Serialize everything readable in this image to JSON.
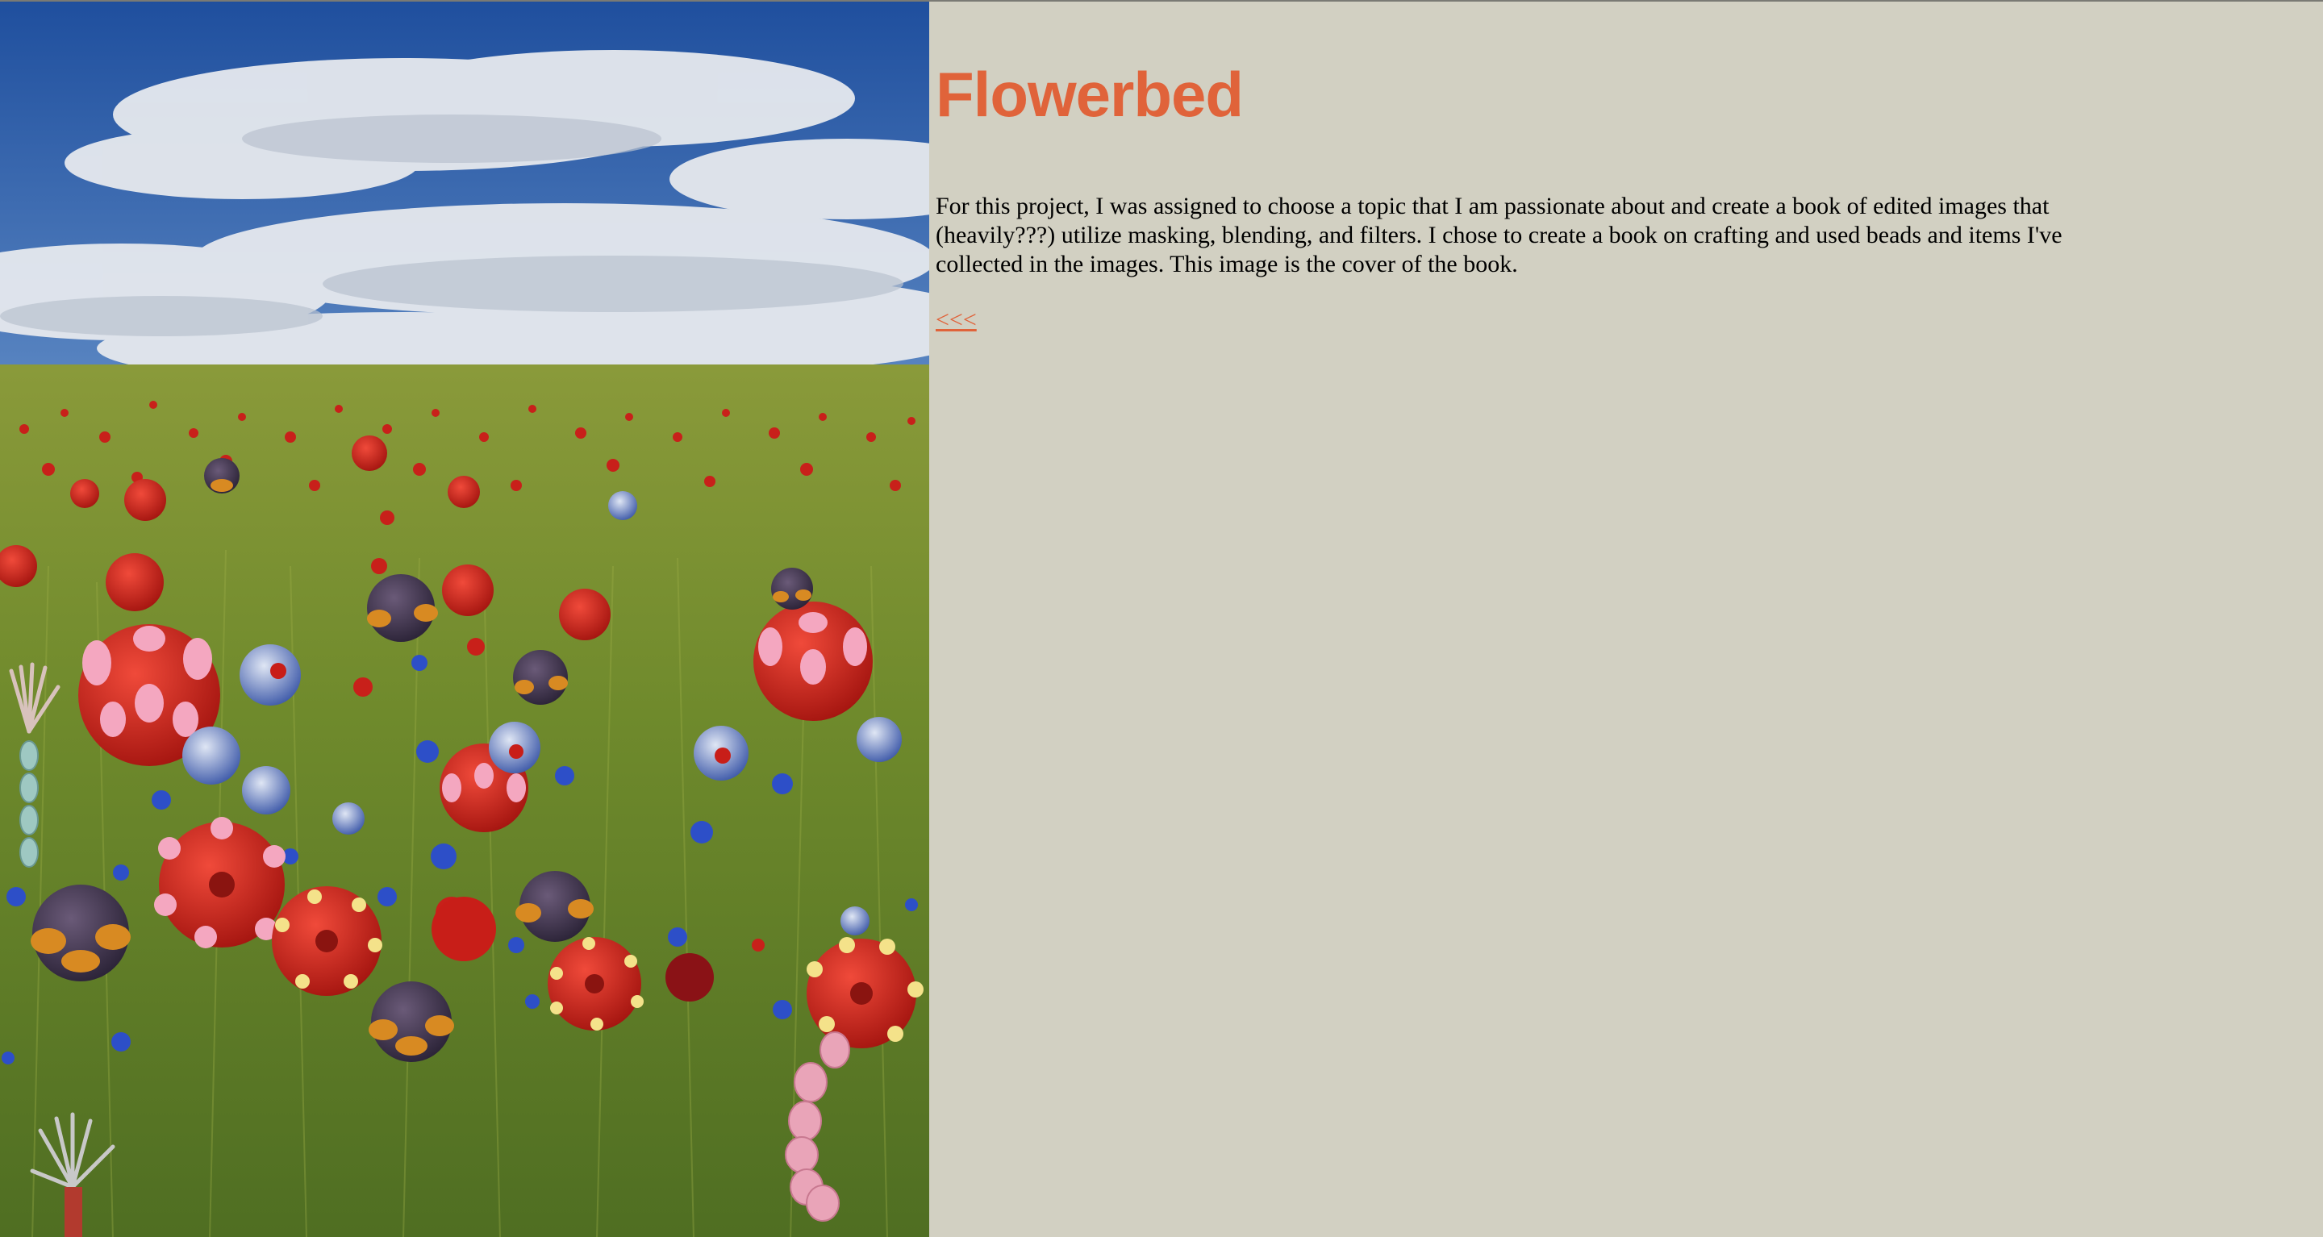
{
  "page": {
    "title": "Flowerbed",
    "description": "For this project, I was assigned to choose a topic that I am passionate about and create a book of edited images that (heavily???) utilize masking, blending, and filters. I chose to create a book on crafting and used beads and items I've collected in the images. This image is the cover of the book.",
    "back_link": "<<<"
  },
  "colors": {
    "accent": "#e0633a",
    "background": "#d2d0c2",
    "sky": "#2f64b2",
    "field": "#6f8a2c"
  },
  "image": {
    "subject": "flowerbed-collage",
    "bead_colors": [
      "#d22a22",
      "#f2a0b8",
      "#3a3550",
      "#f0e07a",
      "#2d4fc8"
    ]
  }
}
